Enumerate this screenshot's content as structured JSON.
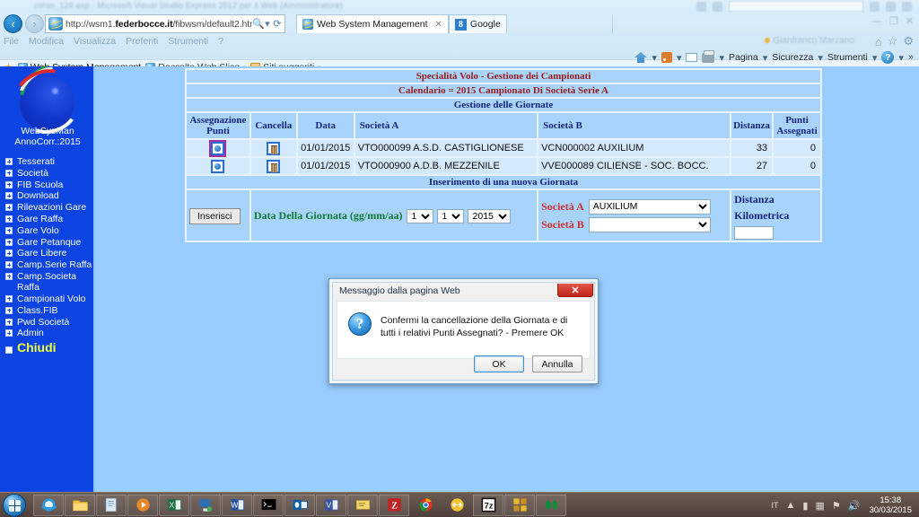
{
  "background_window": {
    "title": "corso_128.asp - Microsoft Visual Studio Express 2012 per il Web (Amministratore)"
  },
  "browser": {
    "address": {
      "url_prefix": "http://wsm1.",
      "url_bold": "federbocce.it",
      "url_suffix": "/fibwsm/default2.htm",
      "go_icon": "search-icon",
      "refresh_icon": "refresh-icon"
    },
    "tabs": [
      {
        "label": "Web System Management",
        "icon": "ie-page-icon",
        "active": true,
        "close_icon": "close-icon"
      },
      {
        "label": "Google",
        "icon": "google-icon",
        "active": false
      }
    ],
    "menu": [
      "File",
      "Modifica",
      "Visualizza",
      "Preferiti",
      "Strumenti",
      "?"
    ],
    "user_chip": "Gianfranco Marzano",
    "favorites": [
      {
        "label": "Web System Management",
        "icon": "ie-page-icon",
        "caret": false
      },
      {
        "label": "Raccolta Web Slice",
        "icon": "ie-page-icon",
        "caret": true
      },
      {
        "label": "Siti suggeriti",
        "icon": "suggested-sites-icon",
        "caret": true
      }
    ],
    "command_bar": [
      {
        "label": "",
        "icon": "home-icon",
        "caret": true
      },
      {
        "label": "",
        "icon": "rss-feed-icon",
        "caret": true
      },
      {
        "label": "",
        "icon": "mail-icon",
        "caret": false
      },
      {
        "label": "",
        "icon": "print-icon",
        "caret": true
      },
      {
        "label": "Pagina",
        "icon": "",
        "caret": true
      },
      {
        "label": "Sicurezza",
        "icon": "",
        "caret": true
      },
      {
        "label": "Strumenti",
        "icon": "",
        "caret": true
      },
      {
        "label": "",
        "icon": "help-icon",
        "caret": true
      }
    ],
    "command_overflow": "»"
  },
  "sidebar": {
    "logo_line1": "WebSysMan",
    "logo_line2": "AnnoCorr.:2015",
    "items": [
      {
        "label": "Tesserati"
      },
      {
        "label": "Società"
      },
      {
        "label": "FIB Scuola"
      },
      {
        "label": "Download"
      },
      {
        "label": "Rilevazioni Gare"
      },
      {
        "label": "Gare Raffa"
      },
      {
        "label": "Gare Volo"
      },
      {
        "label": "Gare Petanque"
      },
      {
        "label": "Gare Libere"
      },
      {
        "label": "Camp.Serie Raffa"
      },
      {
        "label": "Camp.Societa Raffa"
      },
      {
        "label": "Campionati Volo"
      },
      {
        "label": "Class.FIB"
      },
      {
        "label": "Pwd Società"
      },
      {
        "label": "Admin"
      }
    ],
    "close_label": "Chiudi"
  },
  "main": {
    "title": "Specialità Volo - Gestione dei Campionati",
    "subtitle": "Calendario = 2015   Campionato Di Società Serie A",
    "section_title": "Gestione delle Giornate",
    "columns": [
      "Assegnazione Punti",
      "Cancella",
      "Data",
      "Società A",
      "Società B",
      "Distanza",
      "Punti Assegnati"
    ],
    "rows": [
      {
        "assign_icon": "assign-points-icon",
        "delete_icon": "trash-icon",
        "data": "01/01/2015",
        "societa_a": "VTO000099 A.S.D. CASTIGLIONESE",
        "societa_b": "VCN000002  AUXILIUM",
        "distanza": "33",
        "punti": "0",
        "selected": true
      },
      {
        "assign_icon": "assign-points-icon",
        "delete_icon": "trash-icon",
        "data": "01/01/2015",
        "societa_a": "VTO000900 A.D.B. MEZZENILE",
        "societa_b": "VVE000089 CILIENSE - SOC. BOCC.",
        "distanza": "27",
        "punti": "0",
        "selected": false
      }
    ],
    "insert": {
      "title": "Inserimento di una nuova Giornata",
      "button_label": "Inserisci",
      "date_label": "Data Della Giornata (gg/mm/aa)",
      "day_value": "1",
      "month_value": "1",
      "year_value": "2015",
      "societa_a_label": "Società A",
      "societa_a_value": "AUXILIUM",
      "societa_b_label": "Società B",
      "societa_b_value": "",
      "distanza_label": "Distanza Kilometrica",
      "distanza_value": ""
    }
  },
  "dialog": {
    "title": "Messaggio dalla pagina Web",
    "close_label": "✕",
    "icon": "question-icon",
    "icon_glyph": "?",
    "message": "Confermi la cancellazione della Giornata e di tutti i relativi Punti Assegnati? - Premere OK",
    "ok_label": "OK",
    "cancel_label": "Annulla"
  },
  "taskbar": {
    "start_icon": "windows-start-icon",
    "items": [
      {
        "icon": "internet-explorer-icon"
      },
      {
        "icon": "file-explorer-icon"
      },
      {
        "icon": "notepad-icon"
      },
      {
        "icon": "media-player-icon"
      },
      {
        "icon": "excel-icon"
      },
      {
        "icon": "remote-desktop-icon"
      },
      {
        "icon": "word-icon"
      },
      {
        "icon": "command-prompt-icon"
      },
      {
        "icon": "outlook-icon"
      },
      {
        "icon": "visio-icon"
      },
      {
        "icon": "sticky-notes-icon"
      },
      {
        "icon": "filezilla-icon"
      },
      {
        "icon": "chrome-icon"
      },
      {
        "icon": "teamviewer-icon"
      },
      {
        "icon": "7zip-icon"
      },
      {
        "icon": "puzzle-app-icon"
      },
      {
        "icon": "visual-studio-icon"
      }
    ],
    "tray": {
      "language": "IT",
      "icons": [
        "show-hidden-icons",
        "network-icon",
        "antivirus-icon",
        "action-center-icon",
        "volume-icon"
      ],
      "time": "15:38",
      "date": "30/03/2015"
    }
  },
  "colors": {
    "page_background": "#99ccff",
    "sidebar": "#0c44e2",
    "table_header": "#a8d4fb",
    "table_cell": "#d4e9fc",
    "title_red": "#9c1a1a",
    "navy": "#12257e",
    "green_label": "#0f7a33",
    "red_label": "#d2302f",
    "chiudi_yellow": "#f2ff3c",
    "selected_outline": "#a22ea2"
  }
}
